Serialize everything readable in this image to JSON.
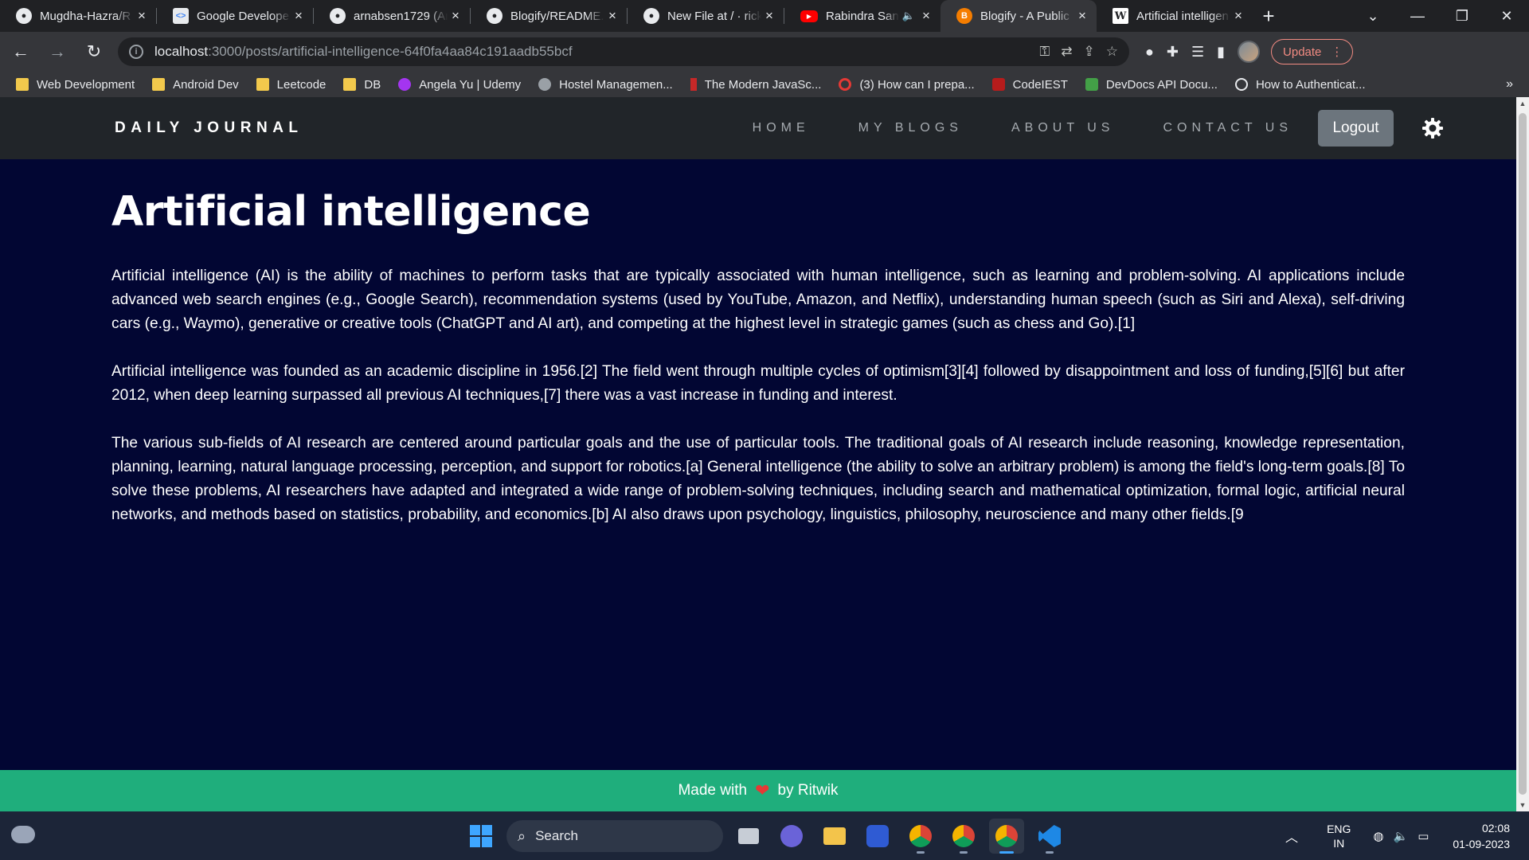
{
  "browser": {
    "tabs": [
      {
        "title": "Mugdha-Hazra/R",
        "icon": "github-icon"
      },
      {
        "title": "Google Develope",
        "icon": "google-developers-icon"
      },
      {
        "title": "arnabsen1729 (Ar",
        "icon": "github-icon"
      },
      {
        "title": "Blogify/README.r",
        "icon": "github-icon"
      },
      {
        "title": "New File at / · rick",
        "icon": "github-icon"
      },
      {
        "title": "Rabindra San",
        "icon": "youtube-icon",
        "audio": true
      },
      {
        "title": "Blogify - A Public",
        "icon": "blogger-icon",
        "active": true
      },
      {
        "title": "Artificial intelligen",
        "icon": "wikipedia-icon"
      }
    ],
    "address": {
      "host": "localhost",
      "path": ":3000/posts/artificial-intelligence-64f0fa4aa84c191aadb55bcf"
    },
    "update_label": "Update",
    "bookmarks": [
      {
        "label": "Web Development",
        "icon": "folder-icon"
      },
      {
        "label": "Android Dev",
        "icon": "folder-icon"
      },
      {
        "label": "Leetcode",
        "icon": "folder-icon"
      },
      {
        "label": "DB",
        "icon": "folder-icon"
      },
      {
        "label": "Angela Yu | Udemy",
        "icon": "udemy-icon"
      },
      {
        "label": "Hostel Managemen...",
        "icon": "globe-icon"
      },
      {
        "label": "The Modern JavaSc...",
        "icon": "person-icon"
      },
      {
        "label": "(3) How can I prepa...",
        "icon": "quora-icon"
      },
      {
        "label": "CodeIEST",
        "icon": "codeiest-icon"
      },
      {
        "label": "DevDocs API Docu...",
        "icon": "devdocs-icon"
      },
      {
        "label": "How to Authenticat...",
        "icon": "code-icon"
      }
    ],
    "bookmarks_more": "»"
  },
  "site": {
    "brand": "DAILY JOURNAL",
    "nav": {
      "home": "HOME",
      "my_blogs": "MY BLOGS",
      "about": "ABOUT US",
      "contact": "CONTACT US",
      "logout": "Logout"
    },
    "article": {
      "title": "Artificial intelligence",
      "paragraphs": [
        "Artificial intelligence (AI) is the ability of machines to perform tasks that are typically associated with human intelligence, such as learning and problem-solving. AI applications include advanced web search engines (e.g., Google Search), recommendation systems (used by YouTube, Amazon, and Netflix), understanding human speech (such as Siri and Alexa), self-driving cars (e.g., Waymo), generative or creative tools (ChatGPT and AI art), and competing at the highest level in strategic games (such as chess and Go).[1]",
        "Artificial intelligence was founded as an academic discipline in 1956.[2] The field went through multiple cycles of optimism[3][4] followed by disappointment and loss of funding,[5][6] but after 2012, when deep learning surpassed all previous AI techniques,[7] there was a vast increase in funding and interest.",
        "The various sub-fields of AI research are centered around particular goals and the use of particular tools. The traditional goals of AI research include reasoning, knowledge representation, planning, learning, natural language processing, perception, and support for robotics.[a] General intelligence (the ability to solve an arbitrary problem) is among the field's long-term goals.[8] To solve these problems, AI researchers have adapted and integrated a wide range of problem-solving techniques, including search and mathematical optimization, formal logic, artificial neural networks, and methods based on statistics, probability, and economics.[b] AI also draws upon psychology, linguistics, philosophy, neuroscience and many other fields.[9"
      ]
    },
    "footer": {
      "before": "Made with",
      "after": "by Ritwik"
    }
  },
  "taskbar": {
    "search_label": "Search",
    "apps": [
      "file-explorer-icon",
      "meet-icon",
      "folder-icon",
      "vs-icon",
      "chrome-icon",
      "chrome-icon",
      "chrome-icon",
      "vscode-icon"
    ],
    "lang_line1": "ENG",
    "lang_line2": "IN",
    "time": "02:08",
    "date": "01-09-2023"
  },
  "colors": {
    "page_bg": "#020633",
    "nav_bg": "#212529",
    "footer_bg": "#1fae7c",
    "logout_bg": "#6c757d"
  }
}
